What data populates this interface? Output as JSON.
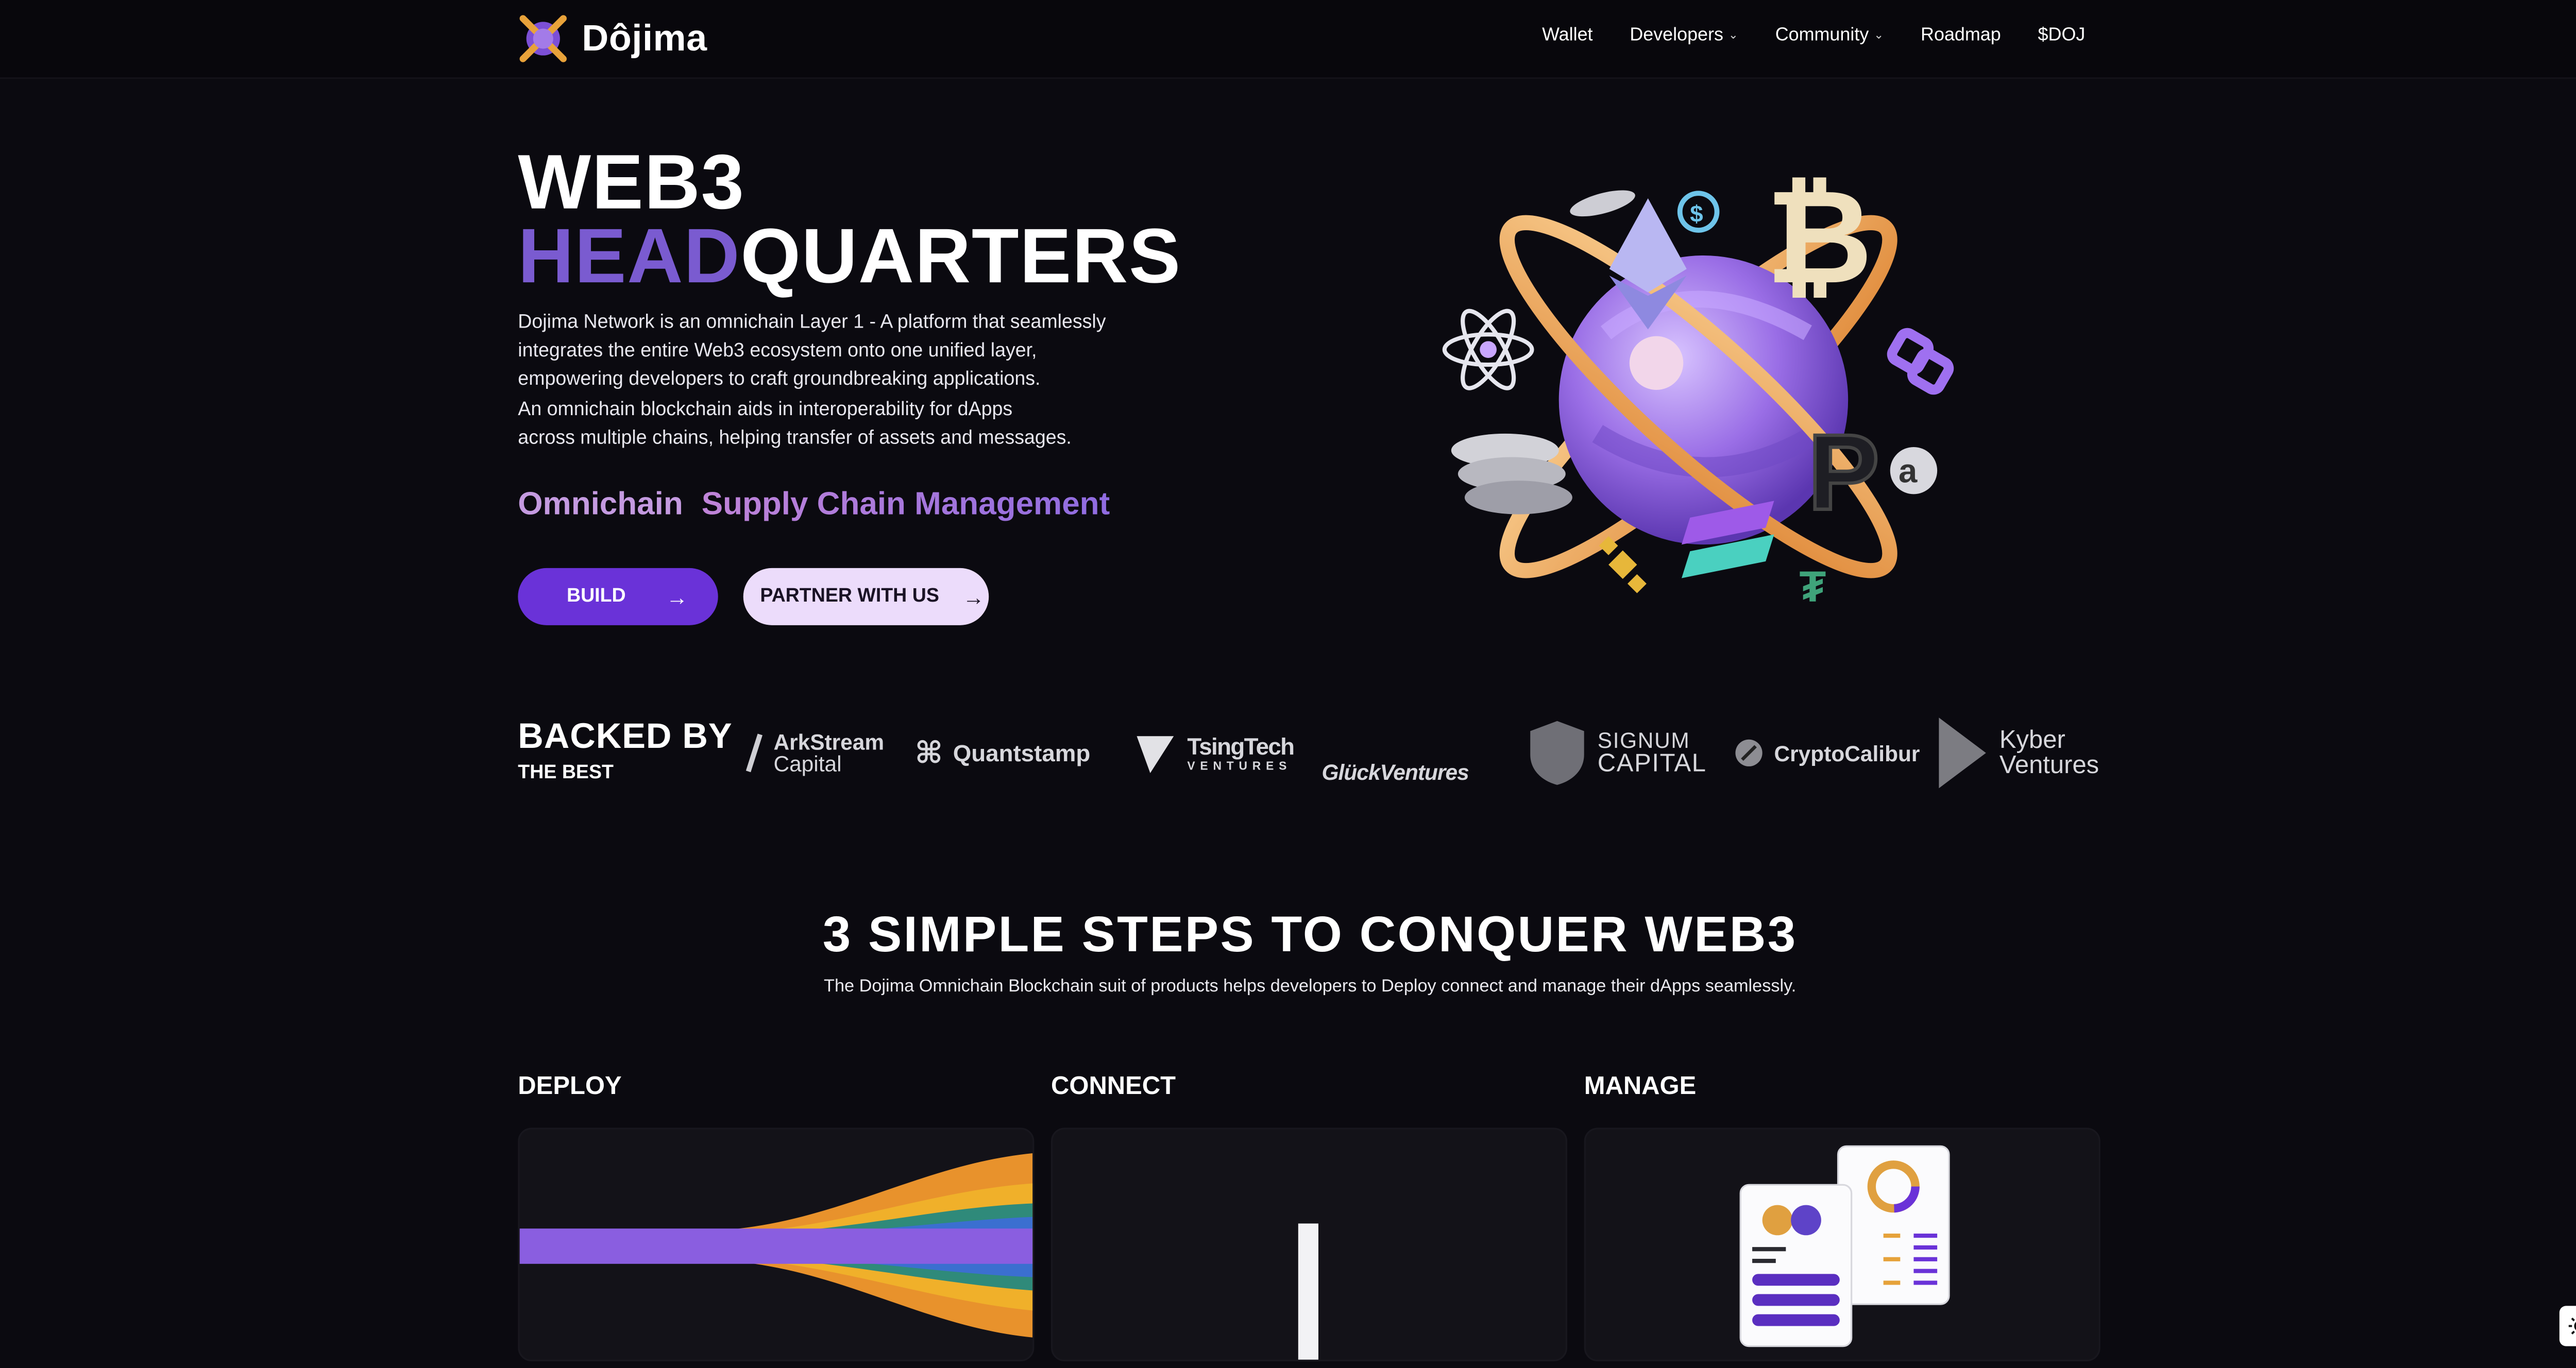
{
  "nav": {
    "logo_text": "Dôjima",
    "links": [
      {
        "label": "Wallet"
      },
      {
        "label": "Developers"
      },
      {
        "label": "Community"
      },
      {
        "label": "Roadmap"
      },
      {
        "label": "$DOJ"
      }
    ]
  },
  "hero": {
    "title_line1": "WEB3",
    "title_line2_accent": "HEAD",
    "title_line2_rest": "QUARTERS",
    "description": [
      "Dojima Network is an omnichain Layer 1 - A platform that seamlessly",
      "integrates the entire Web3 ecosystem onto one unified layer,",
      "empowering developers to craft groundbreaking applications.",
      "An omnichain blockchain aids in interoperability for dApps",
      "across multiple chains, helping transfer of assets and messages."
    ],
    "rotating_word1": "Omnichain",
    "rotating_word2": "Supply Chain Management",
    "build_label": "BUILD",
    "partner_label": "PARTNER WITH US"
  },
  "backed": {
    "title": "BACKED BY",
    "subtitle": "THE BEST",
    "logos": {
      "arkstream_1": "ArkStream",
      "arkstream_2": "Capital",
      "quantstamp": "Quantstamp",
      "tsingtech_1": "TsingTech",
      "tsingtech_2": "VENTURES",
      "gluck": "GlückVentures",
      "signum_1": "SIGNUM",
      "signum_2": "CAPITAL",
      "cryptocalibur": "CryptoCalibur",
      "kyber_1": "Kyber",
      "kyber_2": "Ventures"
    }
  },
  "steps": {
    "title": "3 SIMPLE STEPS TO CONQUER WEB3",
    "subtitle": "The Dojima Omnichain Blockchain suit of products helps developers to Deploy connect and manage their dApps seamlessly.",
    "columns": [
      {
        "label": "DEPLOY"
      },
      {
        "label": "CONNECT"
      },
      {
        "label": "MANAGE"
      }
    ]
  },
  "colors": {
    "accent_purple": "#6a32d8",
    "head_purple": "#7a5bd0",
    "partner_bg": "#ecdcfb",
    "background": "#0b0a10"
  }
}
